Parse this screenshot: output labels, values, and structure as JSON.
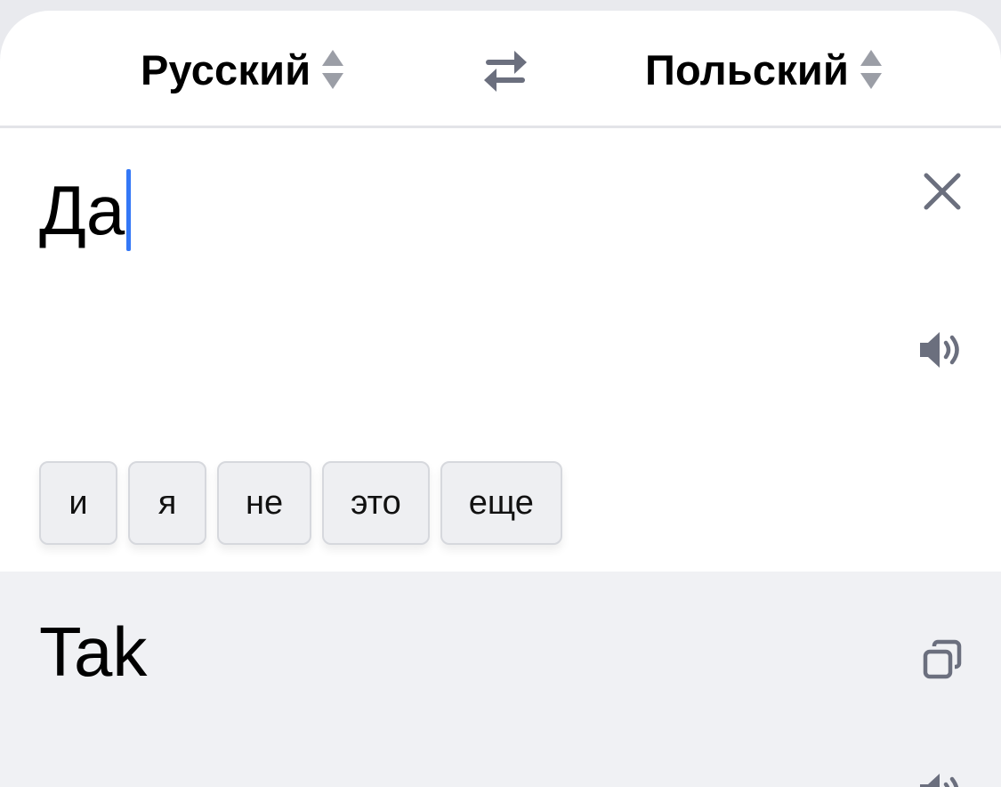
{
  "languages": {
    "source": "Русский",
    "target": "Польский"
  },
  "input": {
    "text": "Да"
  },
  "suggestions": [
    "и",
    "я",
    "не",
    "это",
    "еще"
  ],
  "translation": {
    "text": "Tak"
  },
  "icons": {
    "swap": "swap-arrows-icon",
    "clear": "close-icon",
    "speak": "speaker-icon",
    "copy": "copy-icon"
  },
  "colors": {
    "caret": "#3478f6",
    "icon": "#6b6f7e"
  }
}
